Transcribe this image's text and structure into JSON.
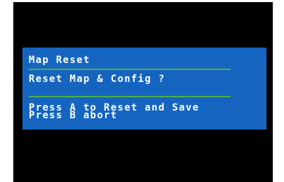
{
  "colors": {
    "screen_background": "#000000",
    "dialog_background": "#1565c0",
    "divider": "#4caf50",
    "text": "#ffffff"
  },
  "dialog": {
    "title": "Map Reset",
    "question": "Reset Map & Config ?",
    "instructions": [
      "Press A to Reset and Save",
      "Press B abort"
    ]
  }
}
